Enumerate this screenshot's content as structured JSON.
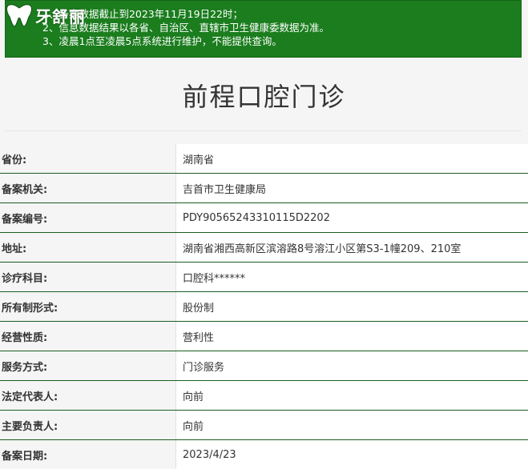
{
  "brand": {
    "name": "牙舒丽"
  },
  "notice": {
    "lines": [
      "1、备案数据截止到2023年11月19日22时；",
      "2、信息数据结果以各省、自治区、直辖市卫生健康委数据为准。",
      "3、凌晨1点至凌晨5点系统进行维护，不能提供查询。"
    ]
  },
  "page": {
    "title": "前程口腔门诊"
  },
  "details": [
    {
      "label": "省份:",
      "value": "湖南省"
    },
    {
      "label": "备案机关:",
      "value": "吉首市卫生健康局"
    },
    {
      "label": "备案编号:",
      "value": "PDY90565243310115D2202"
    },
    {
      "label": "地址:",
      "value": "湖南省湘西高新区滨溶路8号溶江小区第S3-1幢209、210室"
    },
    {
      "label": "诊疗科目:",
      "value": "口腔科******"
    },
    {
      "label": "所有制形式:",
      "value": "股份制"
    },
    {
      "label": "经营性质:",
      "value": "营利性"
    },
    {
      "label": "服务方式:",
      "value": "门诊服务"
    },
    {
      "label": "法定代表人:",
      "value": "向前"
    },
    {
      "label": "主要负责人:",
      "value": "向前"
    },
    {
      "label": "备案日期:",
      "value": "2023/4/23"
    }
  ]
}
